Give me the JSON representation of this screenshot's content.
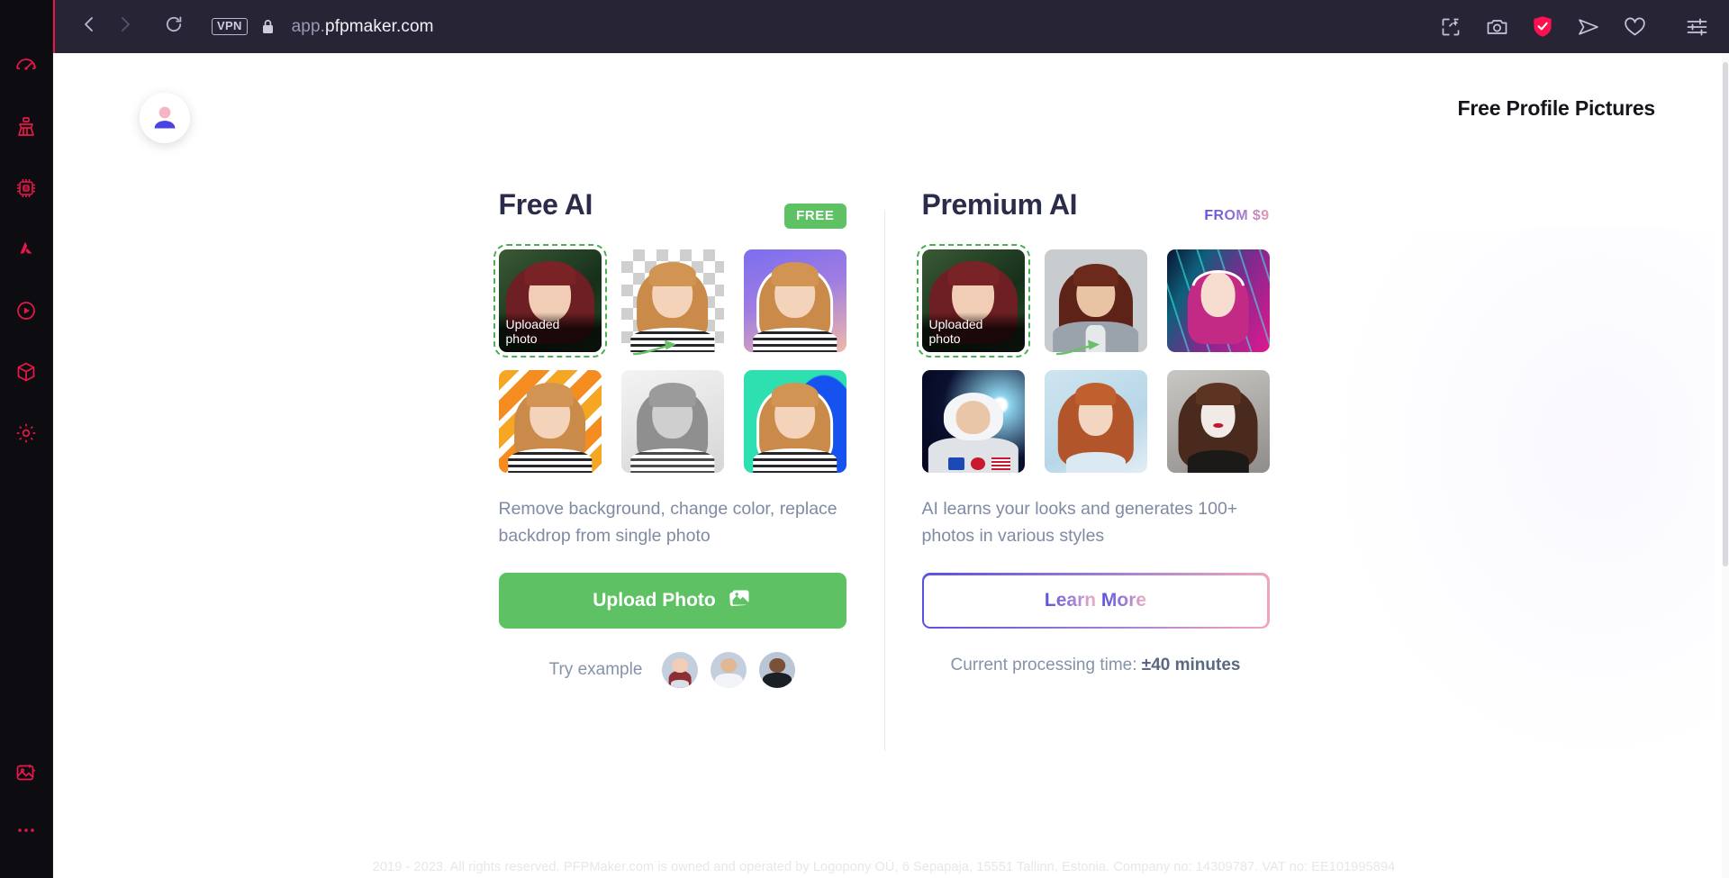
{
  "browser": {
    "back_icon": "chevron-left-icon",
    "forward_icon": "chevron-right-icon",
    "reload_icon": "reload-icon",
    "vpn_label": "VPN",
    "lock_icon": "lock-icon",
    "url_prefix": "app.",
    "url_main": "pfpmaker.com",
    "actions": [
      {
        "name": "snapshot-pin-icon",
        "label": "Pin to window"
      },
      {
        "name": "camera-icon",
        "label": "Snapshot"
      },
      {
        "name": "shield-check-icon",
        "label": "Ad blocker",
        "color": "#ff1150"
      },
      {
        "name": "send-icon",
        "label": "Send"
      },
      {
        "name": "heart-icon",
        "label": "Favorites"
      },
      {
        "name": "sliders-icon",
        "label": "Easy setup"
      }
    ]
  },
  "rail": {
    "top_items": [
      {
        "name": "sidebar-item-speedometer",
        "icon": "speedometer-icon"
      },
      {
        "name": "sidebar-item-cleaner",
        "icon": "broom-icon"
      },
      {
        "name": "sidebar-item-limiter",
        "icon": "cpu-chip-icon"
      },
      {
        "name": "sidebar-item-gx-logo",
        "icon": "gx-logo-icon"
      },
      {
        "name": "sidebar-item-player",
        "icon": "play-circle-icon"
      },
      {
        "name": "sidebar-item-mods",
        "icon": "cube-icon"
      },
      {
        "name": "sidebar-item-settings",
        "icon": "gear-icon"
      }
    ],
    "bottom_items": [
      {
        "name": "sidebar-item-image-editor",
        "icon": "image-wand-icon"
      },
      {
        "name": "sidebar-item-more",
        "icon": "ellipsis-icon"
      }
    ]
  },
  "page": {
    "logo_icon": "user-avatar-logo",
    "title": "Free Profile Pictures",
    "footer": "2019 - 2023. All rights reserved. PFPMaker.com is owned and operated by Logopony OÜ, 6 Sepapaja, 15551 Tallinn, Estonia. Company no: 14309787. VAT no: EE101995894"
  },
  "free_card": {
    "title": "Free AI",
    "badge": "FREE",
    "badge_color": "#5ec264",
    "thumbs": [
      {
        "name": "thumb-uploaded-photo",
        "label": "Uploaded photo",
        "style": "original"
      },
      {
        "name": "thumb-transparent-background",
        "label": "",
        "style": "transparent"
      },
      {
        "name": "thumb-purple-gradient",
        "label": "",
        "style": "purple-gradient"
      },
      {
        "name": "thumb-orange-pattern",
        "label": "",
        "style": "orange-pattern"
      },
      {
        "name": "thumb-grayscale",
        "label": "",
        "style": "grayscale"
      },
      {
        "name": "thumb-teal-blue",
        "label": "",
        "style": "teal-blue"
      }
    ],
    "description": "Remove background, change color, replace backdrop from single photo",
    "button_label": "Upload Photo",
    "button_icon": "photos-icon",
    "button_color": "#5ec264",
    "try_label": "Try example",
    "examples": [
      {
        "name": "example-avatar-1"
      },
      {
        "name": "example-avatar-2"
      },
      {
        "name": "example-avatar-3"
      }
    ]
  },
  "premium_card": {
    "title": "Premium AI",
    "badge": "FROM $9",
    "thumbs": [
      {
        "name": "thumb-uploaded-photo",
        "label": "Uploaded photo",
        "style": "original"
      },
      {
        "name": "thumb-business-portrait",
        "label": "",
        "style": "business"
      },
      {
        "name": "thumb-cyberpunk-neon",
        "label": "",
        "style": "cyberpunk"
      },
      {
        "name": "thumb-astronaut",
        "label": "",
        "style": "astronaut"
      },
      {
        "name": "thumb-watercolor-painting",
        "label": "",
        "style": "painting"
      },
      {
        "name": "thumb-gothic-portrait",
        "label": "",
        "style": "gothic"
      }
    ],
    "description": "AI learns your looks and generates 100+ photos in various styles",
    "button_label_primary": "Learn",
    "button_label_secondary": "More",
    "processing_prefix": "Current processing time: ",
    "processing_value": "±40 minutes"
  }
}
